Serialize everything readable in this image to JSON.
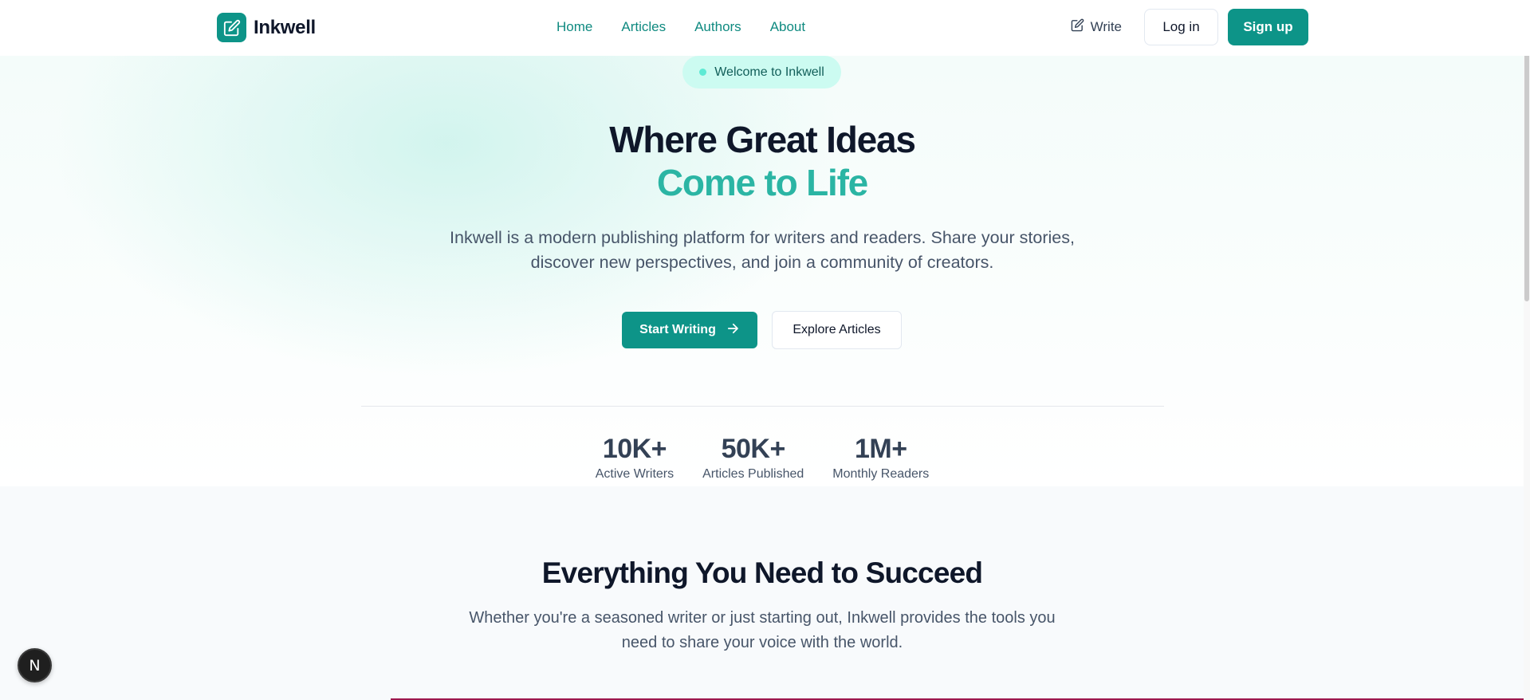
{
  "header": {
    "brand_name": "Inkwell",
    "nav": [
      "Home",
      "Articles",
      "Authors",
      "About"
    ],
    "write_label": "Write",
    "login_label": "Log in",
    "signup_label": "Sign up"
  },
  "hero": {
    "badge": "Welcome to Inkwell",
    "title_line1": "Where Great Ideas",
    "title_line2": "Come to Life",
    "description": "Inkwell is a modern publishing platform for writers and readers. Share your stories, discover new perspectives, and join a community of creators.",
    "start_label": "Start Writing",
    "explore_label": "Explore Articles"
  },
  "stats": [
    {
      "value": "10K+",
      "label": "Active Writers"
    },
    {
      "value": "50K+",
      "label": "Articles Published"
    },
    {
      "value": "1M+",
      "label": "Monthly Readers"
    }
  ],
  "features": {
    "title": "Everything You Need to Succeed",
    "description": "Whether you're a seasoned writer or just starting out, Inkwell provides the tools you need to share your voice with the world."
  },
  "dev_badge": {
    "letter": "N"
  },
  "colors": {
    "brand": "#0d9488",
    "accent_text": "#2bb5a4",
    "badge_bg": "#ccfbf1"
  },
  "icons": {
    "logo": "pencil-square-icon",
    "write": "pencil-square-icon",
    "start": "arrow-right-icon"
  }
}
